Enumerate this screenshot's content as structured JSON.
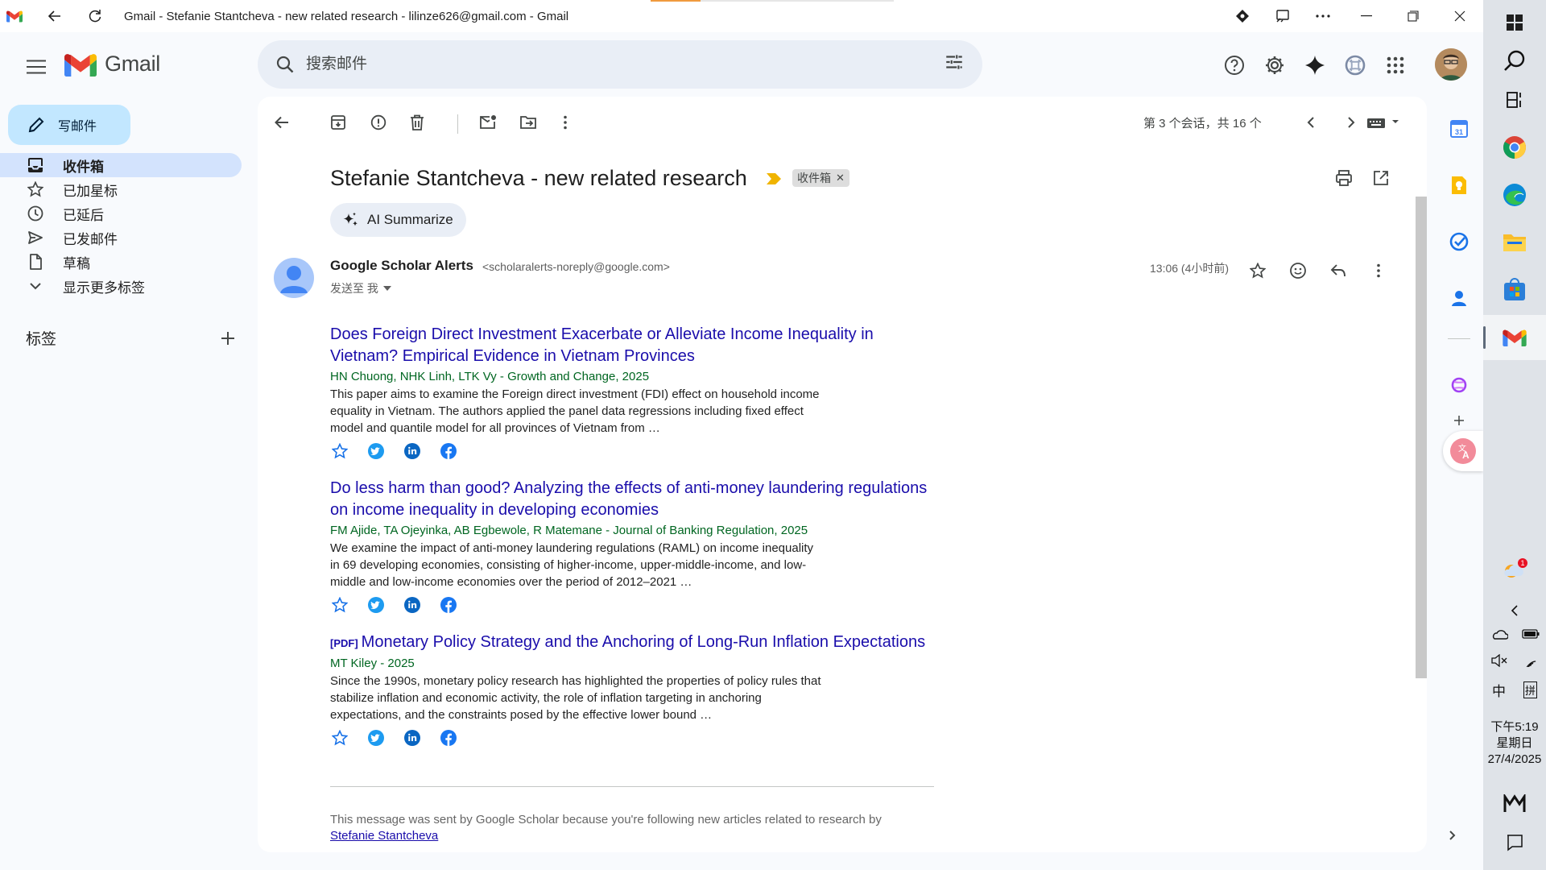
{
  "window": {
    "title": "Gmail - Stefanie Stantcheva - new related research - lilinze626@gmail.com - Gmail"
  },
  "app": {
    "name": "Gmail",
    "search_placeholder": "搜索邮件",
    "compose_label": "写邮件"
  },
  "nav": {
    "items": [
      {
        "label": "收件箱",
        "icon": "inbox-icon",
        "active": true
      },
      {
        "label": "已加星标",
        "icon": "star-icon"
      },
      {
        "label": "已延后",
        "icon": "clock-icon"
      },
      {
        "label": "已发邮件",
        "icon": "send-icon"
      },
      {
        "label": "草稿",
        "icon": "draft-icon"
      },
      {
        "label": "显示更多标签",
        "icon": "chevron-down-icon"
      }
    ],
    "labels_title": "标签"
  },
  "toolbar": {
    "pager": "第 3 个会话，共 16 个"
  },
  "email": {
    "subject": "Stefanie Stantcheva - new related research",
    "label_chip": "收件箱",
    "ai_summarize": "AI Summarize",
    "sender_name": "Google Scholar Alerts",
    "sender_email": "<scholaralerts-noreply@google.com>",
    "to_line": "发送至 我",
    "time": "13:06 (4小时前)",
    "articles": [
      {
        "pdf": "",
        "title": "Does Foreign Direct Investment Exacerbate or Alleviate Income Inequality in Vietnam? Empirical Evidence in Vietnam Provinces",
        "authors": "HN Chuong, NHK Linh, LTK Vy - Growth and Change, 2025",
        "snippet": "This paper aims to examine the Foreign direct investment (FDI) effect on household income equality in Vietnam. The authors applied the panel data regressions including fixed effect model and quantile model for all provinces of Vietnam from …"
      },
      {
        "pdf": "",
        "title": "Do less harm than good? Analyzing the effects of anti-money laundering regulations on income inequality in developing economies",
        "authors": "FM Ajide, TA Ojeyinka, AB Egbewole, R Matemane - Journal of Banking Regulation, 2025",
        "snippet": "We examine the impact of anti-money laundering regulations (RAML) on income inequality in 69 developing economies, consisting of higher-income, upper-middle-income, and low-middle and low-income economies over the period of 2012–2021 …"
      },
      {
        "pdf": "[PDF]",
        "title": "Monetary Policy Strategy and the Anchoring of Long-Run Inflation Expectations",
        "authors": "MT Kiley - 2025",
        "snippet": "Since the 1990s, monetary policy research has highlighted the properties of policy rules that stabilize inflation and economic activity, the role of inflation targeting in anchoring expectations, and the constraints posed by the effective lower bound …"
      }
    ],
    "footer_text": "This message was sent by Google Scholar because you're following new articles related to research by",
    "footer_link": "Stefanie Stantcheva"
  },
  "taskbar": {
    "tray_ime_1": "中",
    "tray_ime_2": "拼",
    "time": "下午5:19",
    "weekday": "星期日",
    "date": "27/4/2025",
    "notification_count": "1"
  },
  "colors": {
    "link": "#1a0dab",
    "authors": "#006621",
    "compose_bg": "#c2e7ff",
    "active_nav": "#d3e3fd",
    "search_bg": "#e9eef6"
  }
}
